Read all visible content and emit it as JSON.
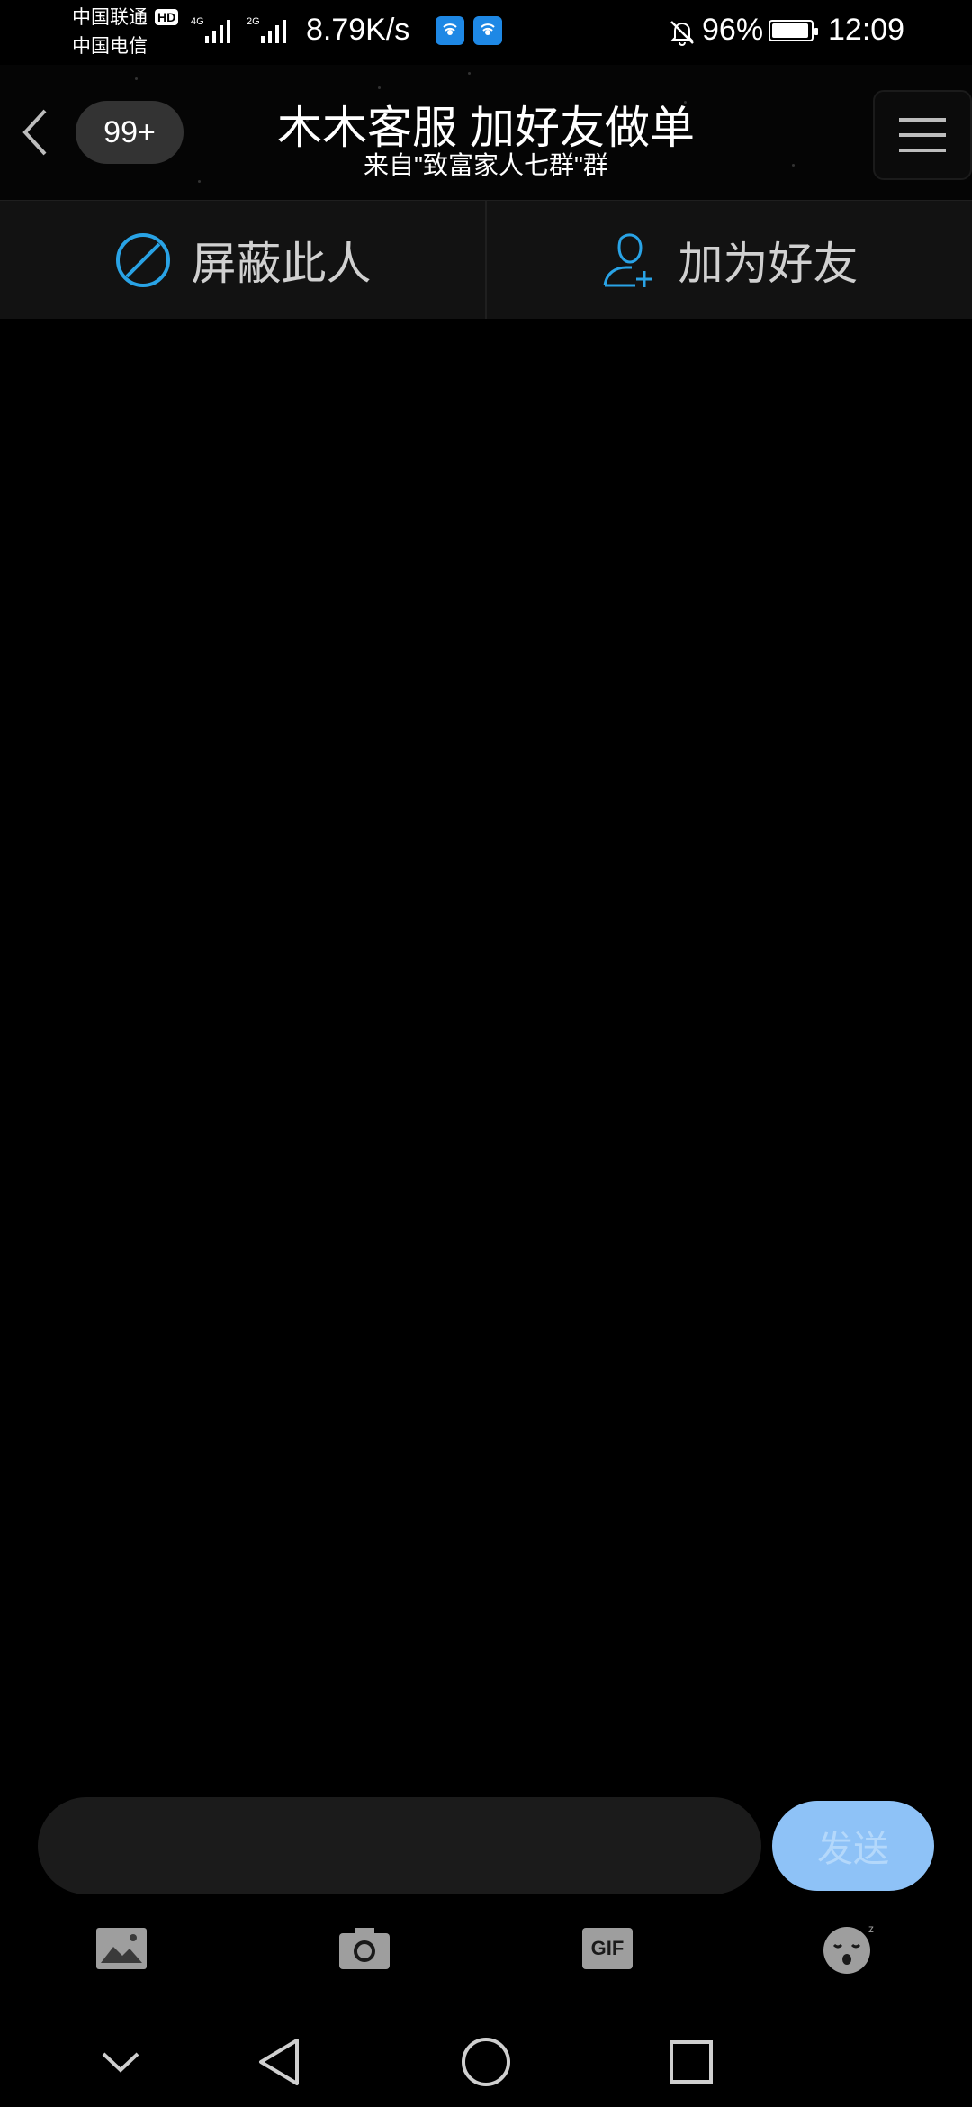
{
  "status_bar": {
    "carrier_1": "中国联通",
    "carrier_1_badge": "HD",
    "carrier_2": "中国电信",
    "network_1": "4G",
    "network_2": "2G",
    "speed": "8.79K/s",
    "battery_percent": "96%",
    "battery_level": 0.96,
    "time": "12:09"
  },
  "header": {
    "unread_count": "99+",
    "title": "木木客服 加好友做单",
    "subtitle": "来自\"致富家人七群\"群"
  },
  "actions": {
    "block_label": "屏蔽此人",
    "add_friend_label": "加为好友"
  },
  "composer": {
    "input_value": "",
    "send_label": "发送"
  },
  "toolbar": {
    "gif_label": "GIF"
  },
  "colors": {
    "accent": "#29a3e6",
    "send_button": "#8ec2f7",
    "background": "#000000"
  },
  "icons": [
    "back-icon",
    "menu-icon",
    "block-icon",
    "add-friend-icon",
    "image-icon",
    "camera-icon",
    "gif-icon",
    "emoji-icon",
    "nav-down-icon",
    "nav-back-icon",
    "nav-home-icon",
    "nav-recents-icon"
  ]
}
